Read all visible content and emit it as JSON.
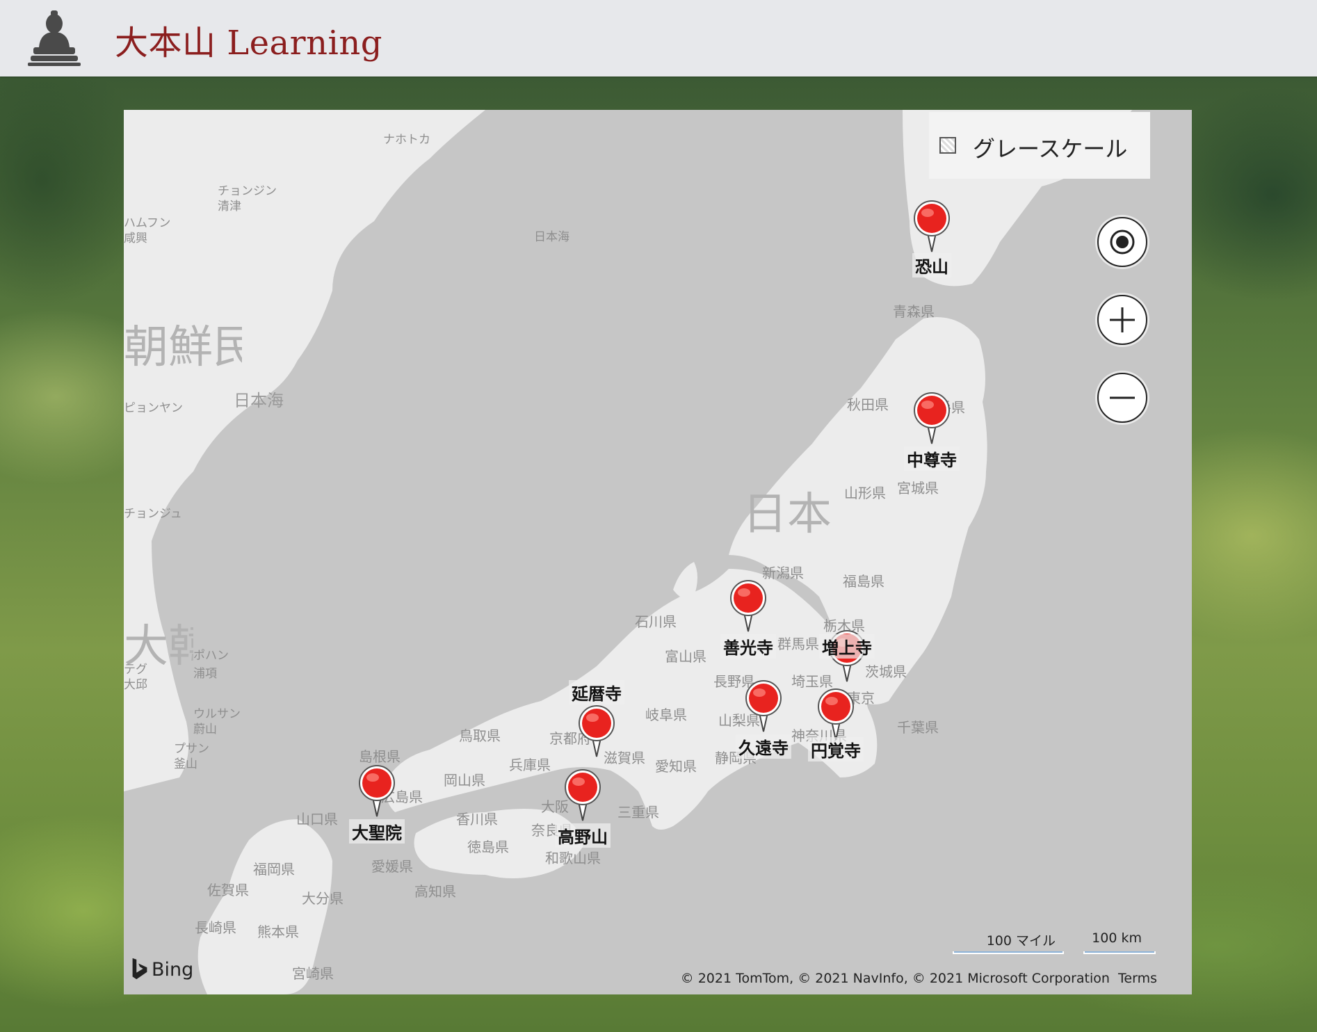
{
  "header": {
    "brand": "大本山 Learning",
    "logo_icon": "buddha-statue-icon"
  },
  "map": {
    "layer_toggle_label": "グレースケール",
    "controls": [
      "locate-me-icon",
      "zoom-in-icon",
      "zoom-out-icon"
    ],
    "sea_labels": [
      "日本海",
      "日本海"
    ],
    "country_labels": [
      "日本"
    ],
    "region_labels": [
      "朝鮮民主主義人民共和国",
      "大韓民国"
    ],
    "city_labels": [
      "ナホトカ",
      "チョンジン",
      "清津",
      "ハムフン",
      "咸興",
      "ポハン",
      "浦項",
      "ウルサン",
      "蔚山",
      "プサン",
      "釜山",
      "テグ",
      "大邱",
      "ピョンヤン",
      "チョンジュ"
    ],
    "prefecture_labels": [
      "青森県",
      "秋田県",
      "岩手県",
      "山形県",
      "宮城県",
      "新潟県",
      "福島県",
      "石川県",
      "富山県",
      "栃木県",
      "群馬県",
      "茨城県",
      "長野県",
      "埼玉県",
      "東京",
      "千葉県",
      "岐阜県",
      "山梨県",
      "神奈川県",
      "静岡県",
      "愛知県",
      "滋賀県",
      "京都府",
      "三重県",
      "鳥取県",
      "兵庫県",
      "島根県",
      "岡山県",
      "広島県",
      "大阪",
      "奈良県",
      "和歌山県",
      "香川県",
      "徳島県",
      "山口県",
      "愛媛県",
      "高知県",
      "福岡県",
      "佐賀県",
      "大分県",
      "長崎県",
      "熊本県",
      "宮崎県"
    ],
    "pins": [
      {
        "name": "恐山"
      },
      {
        "name": "中尊寺"
      },
      {
        "name": "善光寺"
      },
      {
        "name": "増上寺"
      },
      {
        "name": "久遠寺"
      },
      {
        "name": "円覚寺"
      },
      {
        "name": "延暦寺"
      },
      {
        "name": "高野山"
      },
      {
        "name": "大聖院"
      }
    ],
    "scale": {
      "miles": "100 マイル",
      "km": "100 km"
    },
    "attribution": "© 2021 TomTom, © 2021 NavInfo, © 2021 Microsoft Corporation",
    "terms": "Terms",
    "provider": "Bing"
  }
}
